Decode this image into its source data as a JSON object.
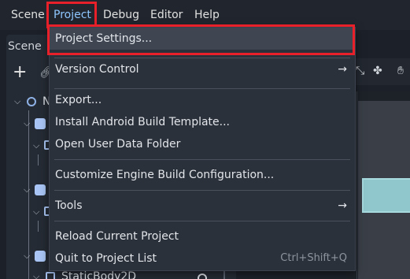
{
  "menubar": {
    "items": [
      "Scene",
      "Project",
      "Debug",
      "Editor",
      "Help"
    ]
  },
  "dock": {
    "tab_label": "Scene",
    "first_node_initial": "N",
    "bottom_node_label": "StaticBody2D"
  },
  "project_menu": {
    "items": [
      {
        "label": "Project Settings...",
        "shortcut": "",
        "submenu": false
      },
      {
        "label": "Version Control",
        "shortcut": "",
        "submenu": true
      },
      {
        "label": "Export...",
        "shortcut": "",
        "submenu": false
      },
      {
        "label": "Install Android Build Template...",
        "shortcut": "",
        "submenu": false
      },
      {
        "label": "Open User Data Folder",
        "shortcut": "",
        "submenu": false
      },
      {
        "label": "Customize Engine Build Configuration...",
        "shortcut": "",
        "submenu": false
      },
      {
        "label": "Tools",
        "shortcut": "",
        "submenu": true
      },
      {
        "label": "Reload Current Project",
        "shortcut": "",
        "submenu": false
      },
      {
        "label": "Quit to Project List",
        "shortcut": "Ctrl+Shift+Q",
        "submenu": false
      }
    ],
    "submenu_arrow": "→"
  },
  "colors": {
    "highlight_box": "#e8202a",
    "active_menu_text": "#8ec6ff",
    "menu_background": "#2b313a"
  },
  "icons": {
    "add_node": "plus-icon",
    "link": "link-icon",
    "node_root": "circle-node-icon",
    "body_node": "body-node-icon",
    "collision_node": "square-node-icon",
    "visibility": "eye-icon"
  }
}
